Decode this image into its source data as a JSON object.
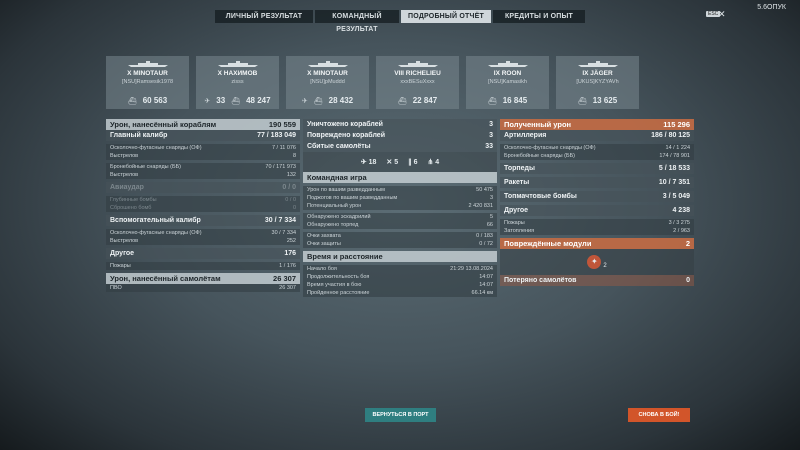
{
  "tabs": [
    {
      "label": "ЛИЧНЫЙ РЕЗУЛЬТАТ"
    },
    {
      "label": "КОМАНДНЫЙ РЕЗУЛЬТАТ"
    },
    {
      "label": "ПОДРОБНЫЙ ОТЧЁТ"
    },
    {
      "label": "КРЕДИТЫ И ОПЫТ"
    }
  ],
  "header": {
    "clock": "5.6ОПУК",
    "esc": "ESC"
  },
  "ships": [
    {
      "name": "X MINOTAUR",
      "player": "[NSU]Ramsesik1978",
      "stats": [
        {
          "icon": "ship-icon",
          "value": "60 563"
        }
      ]
    },
    {
      "name": "X НАХИМОВ",
      "player": "zisss",
      "stats": [
        {
          "icon": "plane-icon",
          "value": "33"
        },
        {
          "icon": "ship-icon",
          "value": "48 247"
        }
      ]
    },
    {
      "name": "X MINOTAUR",
      "player": "[NSU]pMuddd",
      "stats": [
        {
          "icon": "plane-icon",
          "value": ""
        },
        {
          "icon": "ship-icon",
          "value": "28 432"
        }
      ]
    },
    {
      "name": "VIII RICHELIEU",
      "player": "xxxBESuXxxx",
      "stats": [
        {
          "icon": "ship-icon",
          "value": "22 847"
        }
      ]
    },
    {
      "name": "IX ROON",
      "player": "[NSU]Kamasikh",
      "stats": [
        {
          "icon": "ship-icon",
          "value": "16 845"
        }
      ]
    },
    {
      "name": "IX JÄGER",
      "player": "[UKUS]KYZYAVh",
      "stats": [
        {
          "icon": "ship-icon",
          "value": "13 625"
        }
      ]
    }
  ],
  "left": {
    "damage_header": {
      "label": "Урон, нанесённый кораблям",
      "value": "190 559"
    },
    "main_battery": {
      "label": "Главный калибр",
      "value": "77 / 183 049"
    },
    "he_label": "Осколочно-фугасные снаряды (ОФ)",
    "he_value": "7 / 11 076",
    "shots_label": "Выстрелов",
    "he_shots": "8",
    "ap_label": "Бронебойные снаряды (ББ)",
    "ap_value": "70 / 171 973",
    "ap_shots": "132",
    "aviation": {
      "label": "Авиаудар",
      "value": "0 / 0"
    },
    "depth_label": "Глубинные бомбы",
    "depth_value": "0 / 0",
    "dropped_label": "Сброшено бомб",
    "dropped_value": "0",
    "secondary": {
      "label": "Вспомогательный калибр",
      "value": "30 / 7 334"
    },
    "sec_he_value": "30 / 7 334",
    "sec_shots": "252",
    "other": {
      "label": "Другое",
      "value": "176"
    },
    "fires_label": "Пожары",
    "fires_value": "1 / 176",
    "planes_header": {
      "label": "Урон, нанесённый самолётам",
      "value": "26 307"
    },
    "aa_label": "ПВО",
    "aa_value": "26 307"
  },
  "mid": {
    "destroyed": {
      "label": "Уничтожено кораблей",
      "value": "3"
    },
    "damaged": {
      "label": "Повреждено кораблей",
      "value": "3"
    },
    "planes_shot": {
      "label": "Сбитые самолёты",
      "value": "33"
    },
    "icons": [
      {
        "icon": "fighter-icon",
        "value": "18"
      },
      {
        "icon": "bomber-icon",
        "value": "5"
      },
      {
        "icon": "torpedo-bomber-icon",
        "value": "6"
      },
      {
        "icon": "squadron-icon",
        "value": "4"
      }
    ],
    "team_header": "Командная игра",
    "spotting_damage": {
      "label": "Урон по вашим разведданным",
      "value": "50 475"
    },
    "fires_spotted": {
      "label": "Поджогов по вашим разведданным",
      "value": "3"
    },
    "potential": {
      "label": "Потенциальный урон",
      "value": "2 420 831"
    },
    "squads_spotted": {
      "label": "Обнаружено эскадрилий",
      "value": "5"
    },
    "torps_spotted": {
      "label": "Обнаружено торпед",
      "value": "66"
    },
    "capture": {
      "label": "Очки захвата",
      "value": "0 / 183"
    },
    "defense": {
      "label": "Очки защиты",
      "value": "0 / 72"
    },
    "time_header": "Время и расстояние",
    "start": {
      "label": "Начало боя",
      "value": "21:29 13.08.2024"
    },
    "duration": {
      "label": "Продолжительность боя",
      "value": "14:07"
    },
    "participation": {
      "label": "Время участия в бою",
      "value": "14:07"
    },
    "distance": {
      "label": "Пройденное расстояние",
      "value": "66.14 км"
    }
  },
  "right": {
    "received": {
      "label": "Полученный урон",
      "value": "115 296"
    },
    "artillery": {
      "label": "Артиллерия",
      "value": "186 / 80 125"
    },
    "he_value": "14 / 1 224",
    "ap_value": "174 / 78 901",
    "torpedoes": {
      "label": "Торпеды",
      "value": "5 / 18 533"
    },
    "rockets": {
      "label": "Ракеты",
      "value": "10 / 7 351"
    },
    "topbombs": {
      "label": "Топмачтовые бомбы",
      "value": "3 / 5 049"
    },
    "other": {
      "label": "Другое",
      "value": "4 238"
    },
    "fires_value": "3 / 3 275",
    "flooding_label": "Затопления",
    "flooding_value": "2 / 963",
    "modules": {
      "label": "Повреждённые модули",
      "value": "2"
    },
    "module_icon_count": "2",
    "lost_planes": {
      "label": "Потеряно самолётов",
      "value": "0"
    }
  },
  "buttons": {
    "port": "ВЕРНУТЬСЯ В ПОРТ",
    "battle": "СНОВА В БОЙ!"
  }
}
